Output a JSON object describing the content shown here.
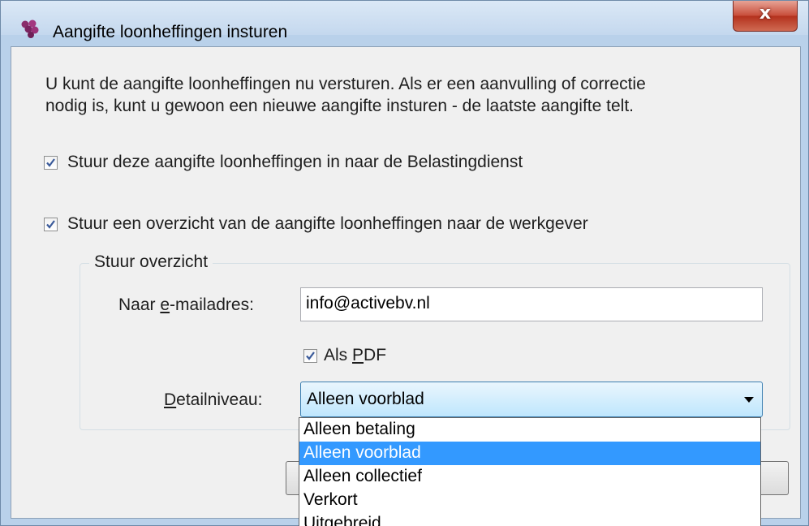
{
  "window": {
    "title": "Aangifte loonheffingen insturen",
    "close_glyph": "x",
    "icon": "app-grapes-icon"
  },
  "intro": {
    "line1": "U kunt de aangifte loonheffingen nu versturen. Als er een aanvulling of correctie",
    "line2": "nodig is, kunt u gewoon een nieuwe aangifte insturen - de laatste aangifte telt."
  },
  "options": {
    "send_to_tax": {
      "label": "Stuur deze aangifte loonheffingen in naar de Belastingdienst",
      "checked": true
    },
    "send_overview": {
      "label": "Stuur een overzicht van de aangifte loonheffingen naar de werkgever",
      "checked": true
    }
  },
  "overview": {
    "group_title": "Stuur overzicht",
    "email_label_pre": "Naar ",
    "email_label_accel": "e",
    "email_label_post": "-mailadres:",
    "email_value": "info@activebv.nl",
    "pdf_label_pre": "Als ",
    "pdf_label_accel": "P",
    "pdf_label_post": "DF",
    "pdf_checked": true,
    "detail_label_accel": "D",
    "detail_label_post": "etailniveau:",
    "detail_selected": "Alleen voorblad",
    "detail_options": [
      "Alleen betaling",
      "Alleen voorblad",
      "Alleen collectief",
      "Verkort",
      "Uitgebreid"
    ],
    "detail_highlight_index": 1
  },
  "colors": {
    "selection": "#3399ff",
    "window_frame": "#b9d1ea",
    "close_button": "#c9503d"
  }
}
